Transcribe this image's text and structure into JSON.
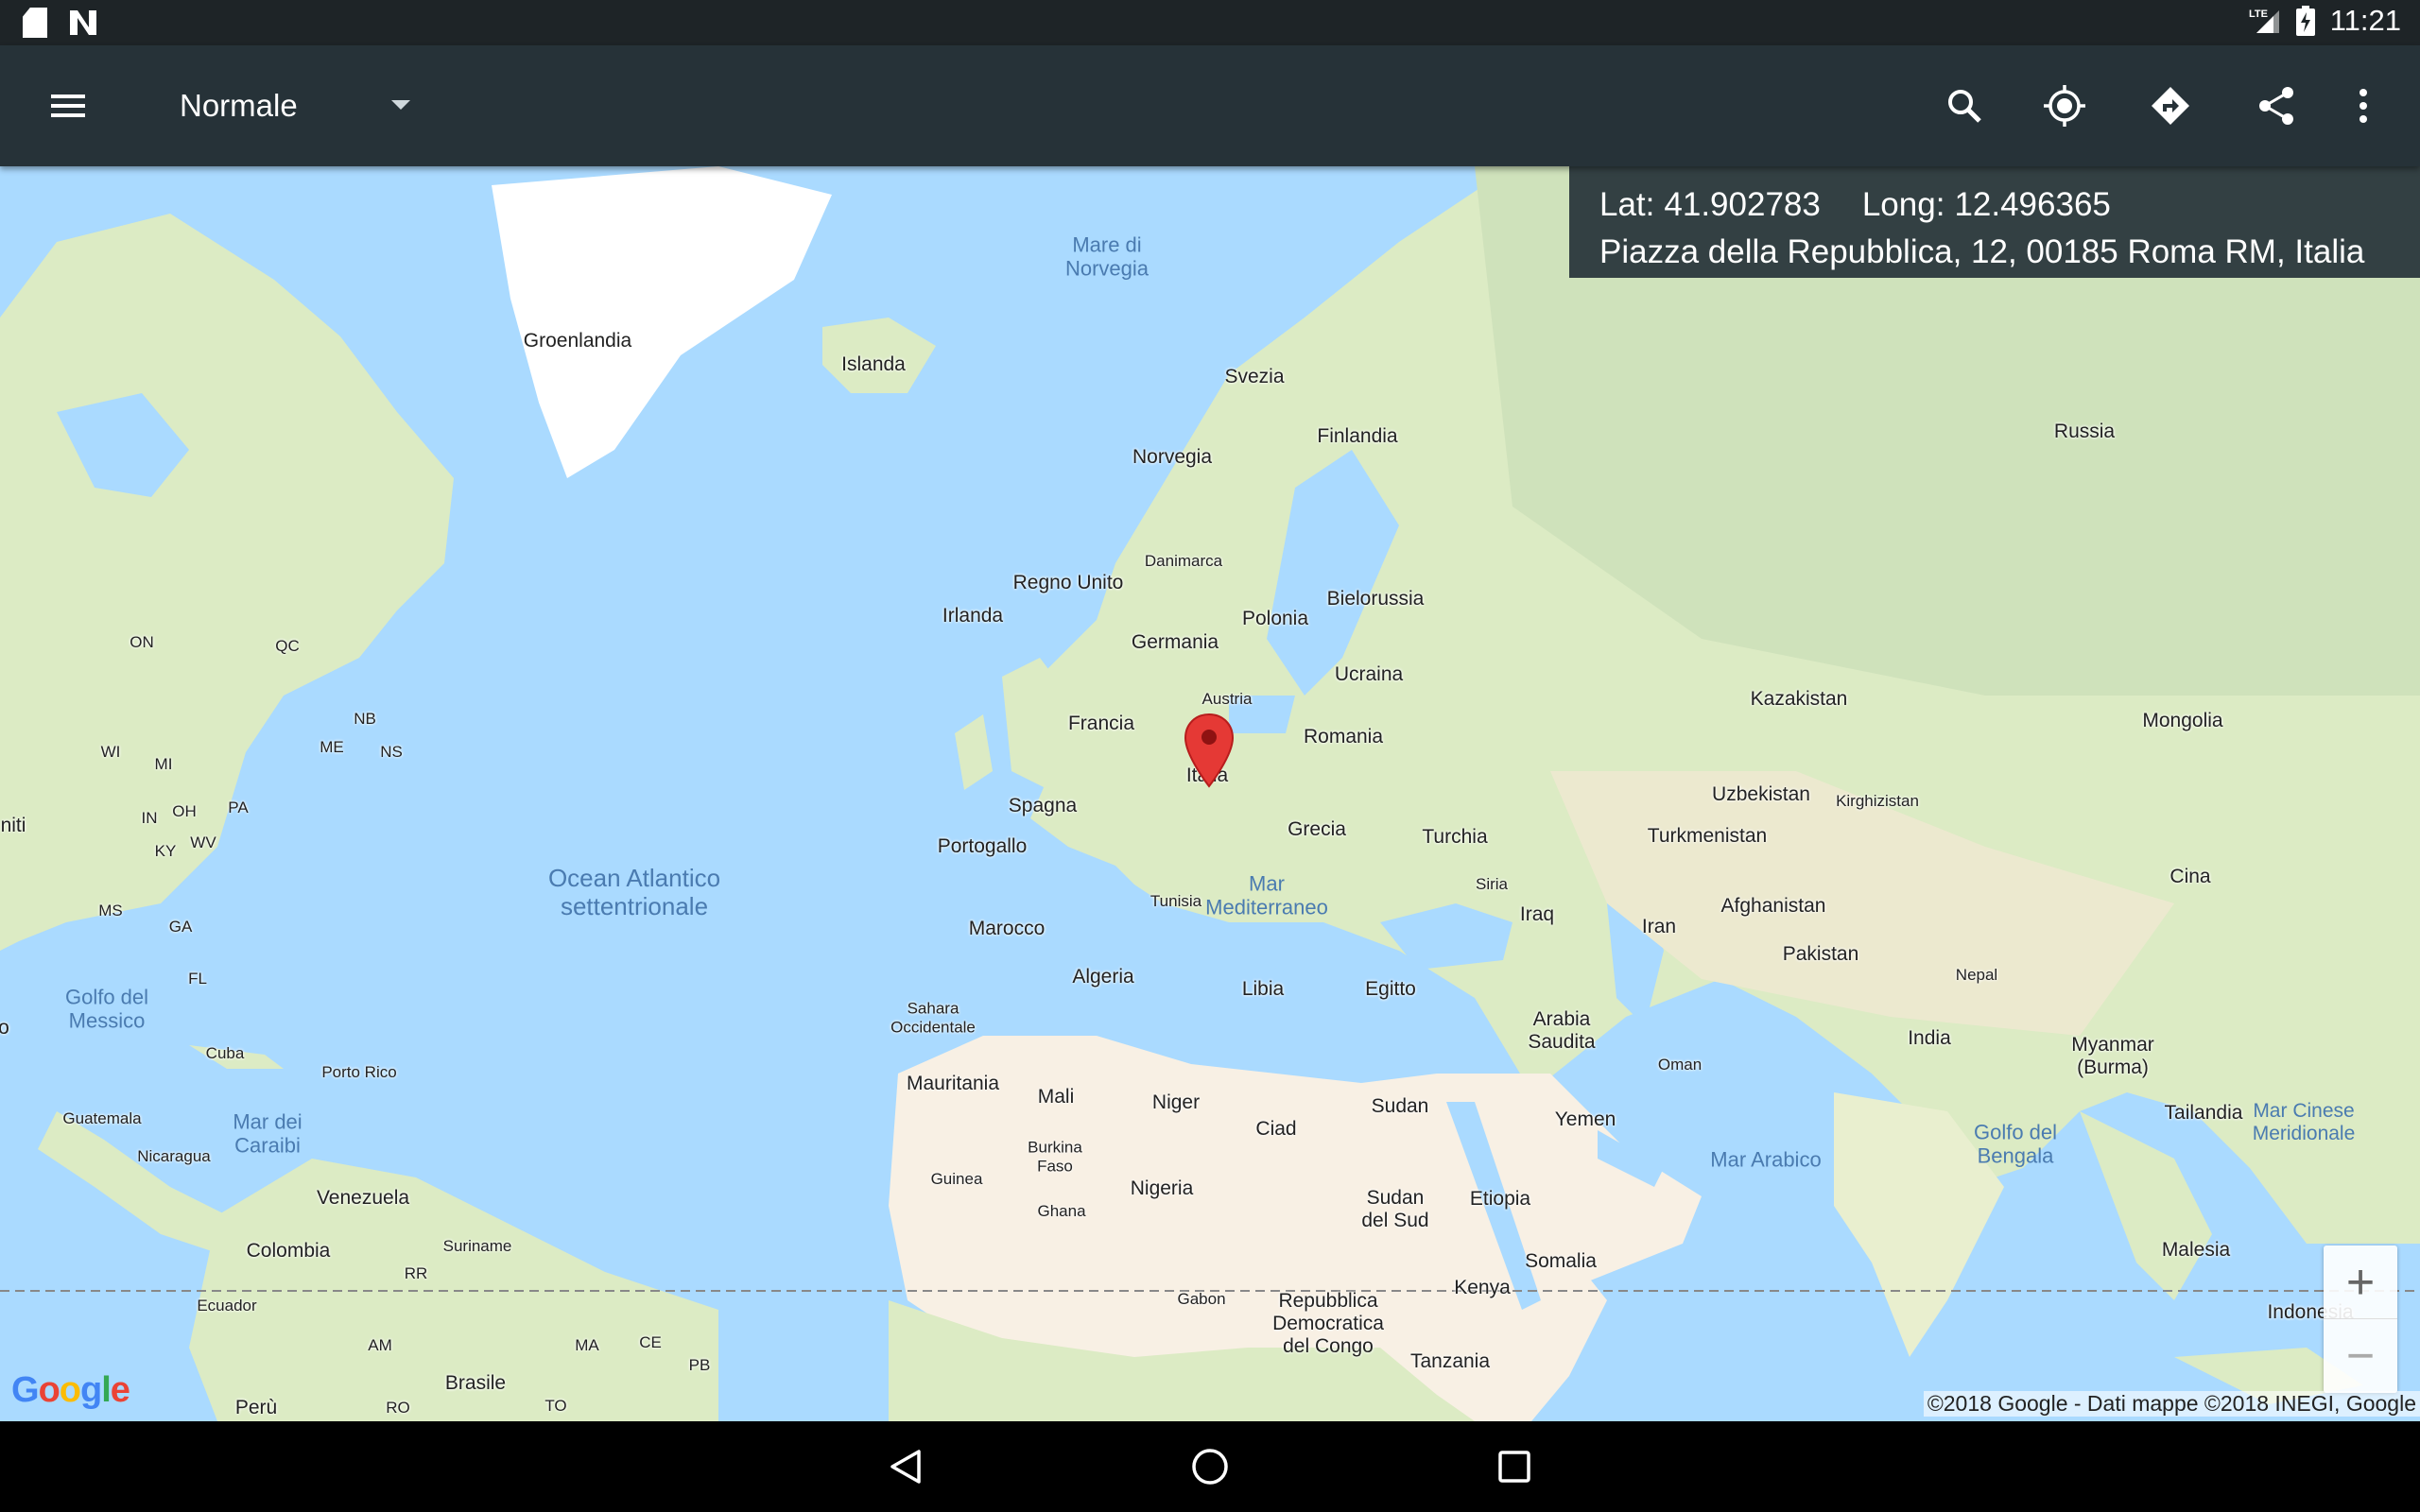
{
  "status_bar": {
    "time": "11:21",
    "icons": [
      "sd-card-icon",
      "notification-n-icon",
      "lte-signal-icon",
      "battery-charging-icon"
    ]
  },
  "toolbar": {
    "map_type": "Normale",
    "actions": [
      "menu-icon",
      "search-icon",
      "my-location-icon",
      "directions-icon",
      "share-icon",
      "more-vert-icon"
    ]
  },
  "coordinates": {
    "lat_label": "Lat:",
    "lat_value": "41.902783",
    "long_label": "Long:",
    "long_value": "12.496365",
    "address": "Piazza della Repubblica, 12, 00185 Roma RM, Italia"
  },
  "map": {
    "labels": {
      "greenland": "Groenlandia",
      "iceland": "Islanda",
      "norwegian_sea": "Mare di Norvegia",
      "sweden": "Svezia",
      "finland": "Finlandia",
      "norway": "Norvegia",
      "russia": "Russia",
      "denmark": "Danimarca",
      "uk": "Regno Unito",
      "ireland": "Irlanda",
      "belarus": "Bielorussia",
      "germany": "Germania",
      "poland": "Polonia",
      "ukraine": "Ucraina",
      "austria": "Austria",
      "france": "Francia",
      "italy": "Italia",
      "romania": "Romania",
      "kazakhstan": "Kazakistan",
      "mongolia": "Mongolia",
      "spain": "Spagna",
      "uzbekistan": "Uzbekistan",
      "kyrgyzstan": "Kirghizistan",
      "portugal": "Portogallo",
      "greece": "Grecia",
      "turkey": "Turchia",
      "turkmenistan": "Turkmenistan",
      "atlantic": "Ocean Atlantico settentrionale",
      "tunisia": "Tunisia",
      "mediterranean": "Mar Mediterraneo",
      "syria": "Siria",
      "iraq": "Iraq",
      "afghanistan": "Afghanistan",
      "china": "Cina",
      "morocco": "Marocco",
      "iran": "Iran",
      "pakistan": "Pakistan",
      "algeria": "Algeria",
      "libya": "Libia",
      "egypt": "Egitto",
      "nepal": "Nepal",
      "western_sahara": "Sahara Occidentale",
      "saudi_arabia": "Arabia Saudita",
      "oman": "Oman",
      "india": "India",
      "myanmar": "Myanmar (Burma)",
      "mauritania": "Mauritania",
      "mali": "Mali",
      "niger": "Niger",
      "sudan": "Sudan",
      "chad": "Ciad",
      "yemen": "Yemen",
      "thailand": "Tailandia",
      "south_china_sea": "Mar Cinese Meridionale",
      "arabian_sea": "Mar Arabico",
      "bay_of_bengal": "Golfo del Bengala",
      "burkina_faso": "Burkina Faso",
      "guinea": "Guinea",
      "nigeria": "Nigeria",
      "south_sudan": "Sudan del Sud",
      "ethiopia": "Etiopia",
      "ghana": "Ghana",
      "somalia": "Somalia",
      "malaysia": "Malesia",
      "gabon": "Gabon",
      "drc": "Repubblica Democratica del Congo",
      "kenya": "Kenya",
      "indonesia": "Indonesia",
      "tanzania": "Tanzania",
      "on": "ON",
      "qc": "QC",
      "nb": "NB",
      "me": "ME",
      "ns": "NS",
      "wi": "WI",
      "mi": "MI",
      "in": "IN",
      "oh": "OH",
      "pa": "PA",
      "ky": "KY",
      "wv": "WV",
      "ms": "MS",
      "ga": "GA",
      "fl": "FL",
      "us_partial": "niti",
      "gulf_mexico": "Golfo del Messico",
      "cuba": "Cuba",
      "puerto_rico": "Porto Rico",
      "guatemala": "Guatemala",
      "caribbean": "Mar dei Caraibi",
      "nicaragua": "Nicaragua",
      "venezuela": "Venezuela",
      "colombia": "Colombia",
      "suriname": "Suriname",
      "rr": "RR",
      "ecuador": "Ecuador",
      "am": "AM",
      "ma": "MA",
      "ce": "CE",
      "pb": "PB",
      "brazil": "Brasile",
      "peru": "Perù",
      "ro": "RO",
      "to": "TO",
      "o_partial": "o"
    },
    "google_logo": "Google",
    "attribution": "©2018 Google - Dati mappe ©2018 INEGI, Google",
    "zoom_in": "+",
    "zoom_out": "−",
    "marker_color": "#e53935"
  },
  "nav_bar": {
    "buttons": [
      "back-icon",
      "home-icon",
      "recents-icon"
    ]
  },
  "colors": {
    "toolbar": "#263238",
    "water": "#aadaff",
    "land": "#e6efd4",
    "desert": "#f8f0e4"
  }
}
